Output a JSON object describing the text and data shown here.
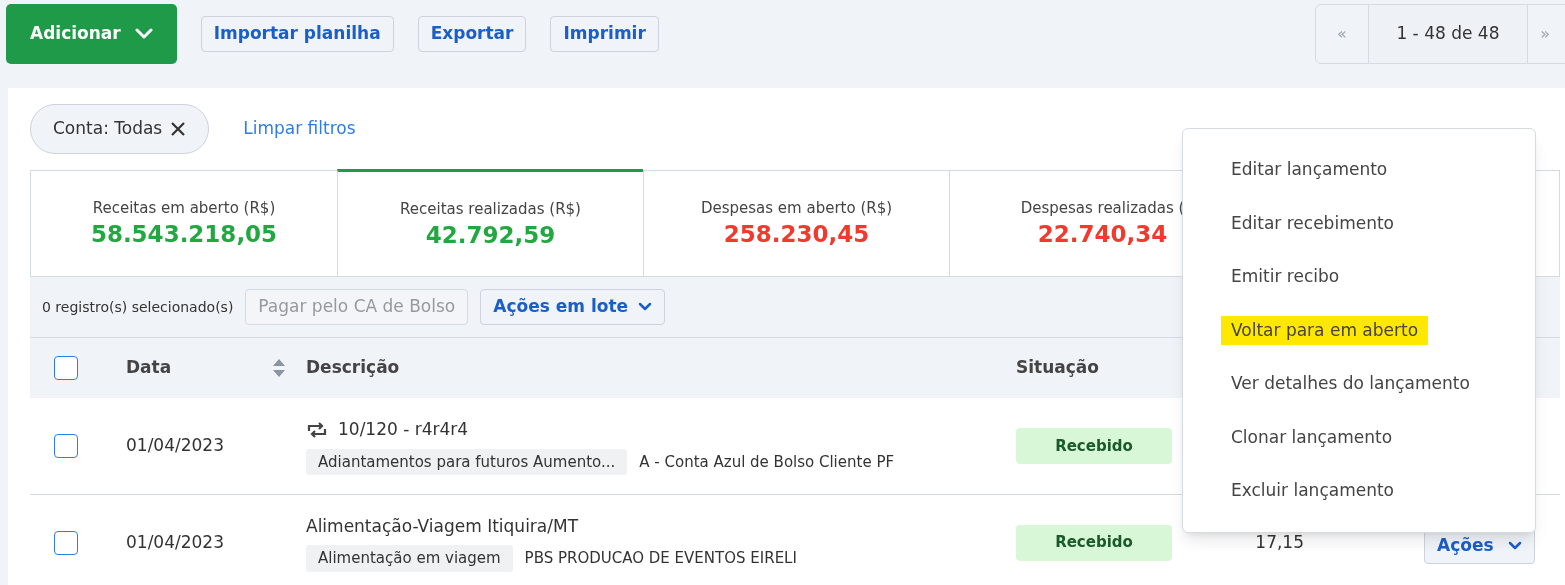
{
  "toolbar": {
    "add_button": "Adicionar",
    "buttons": [
      "Importar planilha",
      "Exportar",
      "Imprimir"
    ],
    "pagination": {
      "prev": "«",
      "range": "1 - 48 de 48",
      "next": "»"
    }
  },
  "filters": {
    "chip": "Conta: Todas",
    "clear": "Limpar filtros"
  },
  "summary": [
    {
      "label": "Receitas em aberto (R$)",
      "value": "58.543.218,05",
      "color": "#22a840",
      "selected": false
    },
    {
      "label": "Receitas realizadas (R$)",
      "value": "42.792,59",
      "color": "#22a840",
      "selected": true
    },
    {
      "label": "Despesas em aberto (R$)",
      "value": "258.230,45",
      "color": "#f03a2e",
      "selected": false
    },
    {
      "label": "Despesas realizadas (",
      "value": "22.740,34",
      "color": "#f03a2e",
      "selected": false
    }
  ],
  "batch": {
    "count": "0 registro(s) selecionado(s)",
    "pay_button": {
      "label": "Pagar pelo CA de Bolso",
      "disabled": true
    },
    "batch_button": "Ações em lote"
  },
  "table": {
    "select_all": {
      "checked": false
    },
    "columns": [
      {
        "label": "Data",
        "sortable": true
      },
      {
        "label": "Descrição",
        "sortable": false
      },
      {
        "label": "Situação",
        "sortable": false
      }
    ],
    "rows": [
      {
        "checked": false,
        "date": "01/04/2023",
        "recurring": true,
        "title": "10/120 - r4r4r4",
        "category": "Adiantamentos para futuros Aumento...",
        "contact": "A - Conta Azul de Bolso Cliente PF",
        "status": "Recebido"
      },
      {
        "checked": false,
        "date": "01/04/2023",
        "recurring": false,
        "title": "Alimentação-Viagem Itiquira/MT",
        "category": "Alimentação em viagem",
        "contact": "PBS PRODUCAO DE EVENTOS EIRELI",
        "status": "Recebido",
        "amount": "17,15",
        "actions": "Ações"
      }
    ]
  },
  "menu": [
    {
      "label": "Editar lançamento",
      "highlighted": false
    },
    {
      "label": "Editar recebimento",
      "highlighted": false
    },
    {
      "label": "Emitir recibo",
      "highlighted": false
    },
    {
      "label": "Voltar para em aberto",
      "highlighted": true
    },
    {
      "label": "Ver detalhes do lançamento",
      "highlighted": false
    },
    {
      "label": "Clonar lançamento",
      "highlighted": false
    },
    {
      "label": "Excluir lançamento",
      "highlighted": false
    }
  ]
}
